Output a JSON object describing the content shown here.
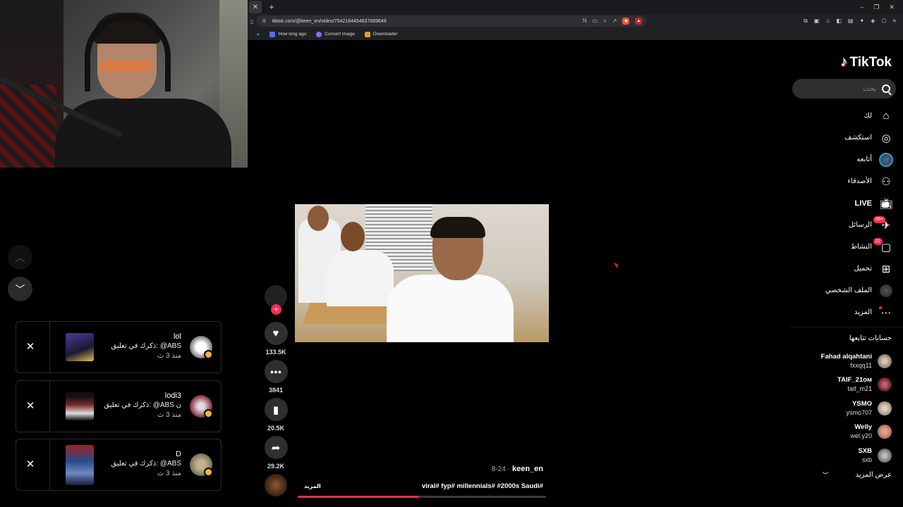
{
  "browser": {
    "url": "tiktok.com/@keen_en/video/7542164454637669649",
    "bookmarks": [
      {
        "label": "How long ago"
      },
      {
        "label": "Convert Image"
      },
      {
        "label": "Downloader"
      }
    ]
  },
  "sidebar": {
    "logo": "TikTok",
    "search_placeholder": "بحث",
    "nav": [
      {
        "label": "لك",
        "icon": "home-icon"
      },
      {
        "label": "استكشف",
        "icon": "compass-icon"
      },
      {
        "label": "أتابعه",
        "icon": "following-avatar-icon"
      },
      {
        "label": "الأصدقاء",
        "icon": "friends-icon"
      },
      {
        "label": "LIVE",
        "icon": "live-tv-icon"
      },
      {
        "label": "الرسائل",
        "icon": "messages-icon",
        "badge": "99+"
      },
      {
        "label": "النشاط",
        "icon": "activity-icon",
        "badge": "11"
      },
      {
        "label": "تحميل",
        "icon": "upload-icon"
      },
      {
        "label": "الملف الشخصي",
        "icon": "profile-avatar-icon"
      },
      {
        "label": "المزيد",
        "icon": "more-dots-icon"
      }
    ],
    "following_title": "حسابات تتابعها",
    "following": [
      {
        "name": "Fahad alqahtani",
        "handle": "fxxqq11",
        "color": "#8a7a6a"
      },
      {
        "name": "TAIF_21ом",
        "handle": "taif_m21",
        "color": "#7a2a3a"
      },
      {
        "name": "YSMO",
        "handle": "ysmo707",
        "color": "#a09080"
      },
      {
        "name": "Welly",
        "handle": "wel.y20",
        "color": "#b07060"
      },
      {
        "name": "SXB",
        "handle": "sxb",
        "color": "#6a6a6a"
      }
    ],
    "show_more": "عرض المزيد"
  },
  "video": {
    "author": "keen_en",
    "date": "8-24",
    "caption": "viral# fyp# millennials# #2000s Saudi#",
    "more_label": "المزيد",
    "progress": 0.49
  },
  "actions": [
    {
      "name": "like",
      "icon": "heart-icon",
      "glyph": "♥",
      "count": "133.5K"
    },
    {
      "name": "comment",
      "icon": "comment-icon",
      "glyph": "•••",
      "count": "3841"
    },
    {
      "name": "save",
      "icon": "bookmark-icon",
      "glyph": "▮",
      "count": "20.5K"
    },
    {
      "name": "share",
      "icon": "share-icon",
      "glyph": "➦",
      "count": "29.2K"
    }
  ],
  "notifications": [
    {
      "name": "lol",
      "message": "ذكرك في تعليق: @ABS",
      "time": "منذ 3 ث",
      "avatar_color": "#e8e8e8",
      "thumb_color": "#4a3aa0"
    },
    {
      "name": "lodi3",
      "message": "ذكرك في تعليق: @ABS ن",
      "time": "منذ 3 ث",
      "avatar_color": "#8a2a3a",
      "thumb_color": "#5a2a2a"
    },
    {
      "name": "D",
      "message": "ذكرك في تعليق: @ABS",
      "time": "منذ 3 ث",
      "avatar_color": "#7a8a6a",
      "thumb_color": "#2a4a8a"
    }
  ]
}
